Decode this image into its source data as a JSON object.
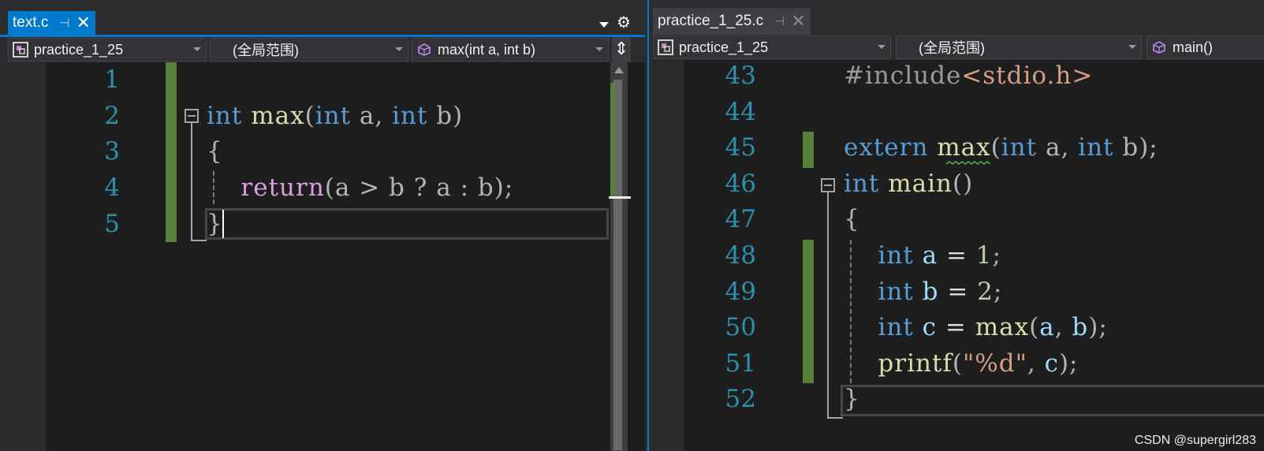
{
  "left_editor": {
    "tab": {
      "title": "text.c",
      "pin_icon": "pin-icon",
      "close_icon": "close-icon"
    },
    "navigation": {
      "project": "practice_1_25",
      "scope": "(全局范围)",
      "member": "max(int a, int b)"
    },
    "lines": [
      {
        "number": "1"
      },
      {
        "number": "2",
        "tokens": [
          [
            "int",
            "kw"
          ],
          [
            " ",
            ""
          ],
          [
            "max",
            "fn"
          ],
          [
            "(",
            "punct"
          ],
          [
            "int",
            "kw"
          ],
          [
            " a, ",
            "punct"
          ],
          [
            "int",
            "kw"
          ],
          [
            " b)",
            "punct"
          ]
        ]
      },
      {
        "number": "3",
        "tokens": [
          [
            "{",
            "punct"
          ]
        ]
      },
      {
        "number": "4",
        "tokens": [
          [
            "    ",
            ""
          ],
          [
            "return",
            "ctl"
          ],
          [
            "(a > b ? a : b);",
            "punct"
          ]
        ]
      },
      {
        "number": "5",
        "tokens": [
          [
            "}",
            "punct"
          ]
        ]
      }
    ]
  },
  "right_editor": {
    "tab": {
      "title": "practice_1_25.c",
      "pin_icon": "pin-icon",
      "close_icon": "close-icon"
    },
    "navigation": {
      "project": "practice_1_25",
      "scope": "(全局范围)",
      "member": "main()"
    },
    "lines": [
      {
        "number": "43",
        "tokens": [
          [
            "#include",
            "pp"
          ],
          [
            "<stdio.h>",
            "inc"
          ]
        ]
      },
      {
        "number": "44"
      },
      {
        "number": "45",
        "tokens": [
          [
            "extern",
            "kw"
          ],
          [
            " ",
            ""
          ],
          [
            "max",
            "fn"
          ],
          [
            "(",
            "punct"
          ],
          [
            "int",
            "kw"
          ],
          [
            " a, ",
            "punct"
          ],
          [
            "int",
            "kw"
          ],
          [
            " b);",
            "punct"
          ]
        ]
      },
      {
        "number": "46",
        "tokens": [
          [
            "int",
            "kw"
          ],
          [
            " ",
            ""
          ],
          [
            "main",
            "fn"
          ],
          [
            "()",
            "punct"
          ]
        ]
      },
      {
        "number": "47",
        "tokens": [
          [
            "{",
            "punct"
          ]
        ]
      },
      {
        "number": "48",
        "tokens": [
          [
            "    ",
            ""
          ],
          [
            "int",
            "kw"
          ],
          [
            " ",
            ""
          ],
          [
            "a",
            "var"
          ],
          [
            " = ",
            ""
          ],
          [
            "1",
            "num"
          ],
          [
            ";",
            "punct"
          ]
        ]
      },
      {
        "number": "49",
        "tokens": [
          [
            "    ",
            ""
          ],
          [
            "int",
            "kw"
          ],
          [
            " ",
            ""
          ],
          [
            "b",
            "var"
          ],
          [
            " = ",
            ""
          ],
          [
            "2",
            "num"
          ],
          [
            ";",
            "punct"
          ]
        ]
      },
      {
        "number": "50",
        "tokens": [
          [
            "    ",
            ""
          ],
          [
            "int",
            "kw"
          ],
          [
            " ",
            ""
          ],
          [
            "c",
            "var"
          ],
          [
            " = ",
            ""
          ],
          [
            "max",
            "fn"
          ],
          [
            "(",
            "punct"
          ],
          [
            "a",
            "var"
          ],
          [
            ", ",
            "punct"
          ],
          [
            "b",
            "var"
          ],
          [
            ");",
            "punct"
          ]
        ]
      },
      {
        "number": "51",
        "tokens": [
          [
            "    ",
            ""
          ],
          [
            "printf",
            "fn"
          ],
          [
            "(",
            "punct"
          ],
          [
            "\"%d\"",
            "str"
          ],
          [
            ", ",
            "punct"
          ],
          [
            "c",
            "var"
          ],
          [
            ");",
            "punct"
          ]
        ]
      },
      {
        "number": "52",
        "tokens": [
          [
            "}",
            "punct"
          ]
        ]
      }
    ]
  },
  "toolbar_icons": [
    "dropdown-arrow-icon",
    "gear-icon",
    "split-icon"
  ],
  "colors": {
    "active_tab": "#007acc",
    "keyword": "#569cd6",
    "function": "#dcdcaa",
    "control": "#d8a0df",
    "variable": "#9cdcfe",
    "number": "#b5cea8",
    "string": "#d69d85",
    "line_number": "#2b91af",
    "change_marker": "#57803a"
  },
  "watermark": "CSDN @supergirl283"
}
